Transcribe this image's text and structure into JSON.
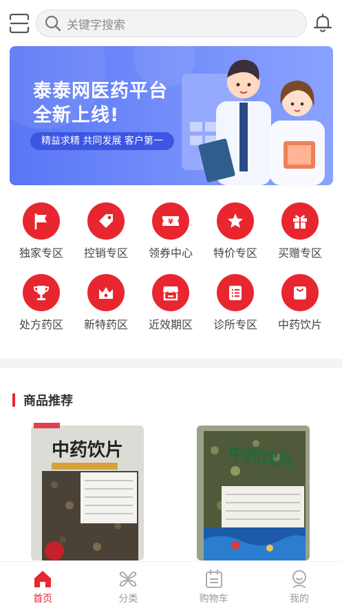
{
  "search": {
    "placeholder": "关键字搜索"
  },
  "banner": {
    "line1": "泰泰网医药平台",
    "line2": "全新上线!",
    "slogan": "精益求精 共同发展 客户第一"
  },
  "categories": [
    {
      "label": "独家专区",
      "icon": "flag-icon"
    },
    {
      "label": "控销专区",
      "icon": "tag-icon"
    },
    {
      "label": "领券中心",
      "icon": "coupon-icon"
    },
    {
      "label": "特价专区",
      "icon": "star-icon"
    },
    {
      "label": "买赠专区",
      "icon": "gift-icon"
    },
    {
      "label": "处方药区",
      "icon": "trophy-icon"
    },
    {
      "label": "新特药区",
      "icon": "crown-icon"
    },
    {
      "label": "近效期区",
      "icon": "store-icon"
    },
    {
      "label": "诊所专区",
      "icon": "list-icon"
    },
    {
      "label": "中药饮片",
      "icon": "bag-icon"
    }
  ],
  "recommend": {
    "title": "商品推荐"
  },
  "products": [
    {
      "bag_text": "中药饮片"
    },
    {
      "bag_text": "中药饮片"
    }
  ],
  "tabs": [
    {
      "label": "首页",
      "icon": "home-icon",
      "active": true
    },
    {
      "label": "分类",
      "icon": "category-icon",
      "active": false
    },
    {
      "label": "购物车",
      "icon": "cart-icon",
      "active": false
    },
    {
      "label": "我的",
      "icon": "user-icon",
      "active": false
    }
  ],
  "colors": {
    "accent": "#e8262f",
    "banner": "#5976f5",
    "inactive": "#999999"
  }
}
